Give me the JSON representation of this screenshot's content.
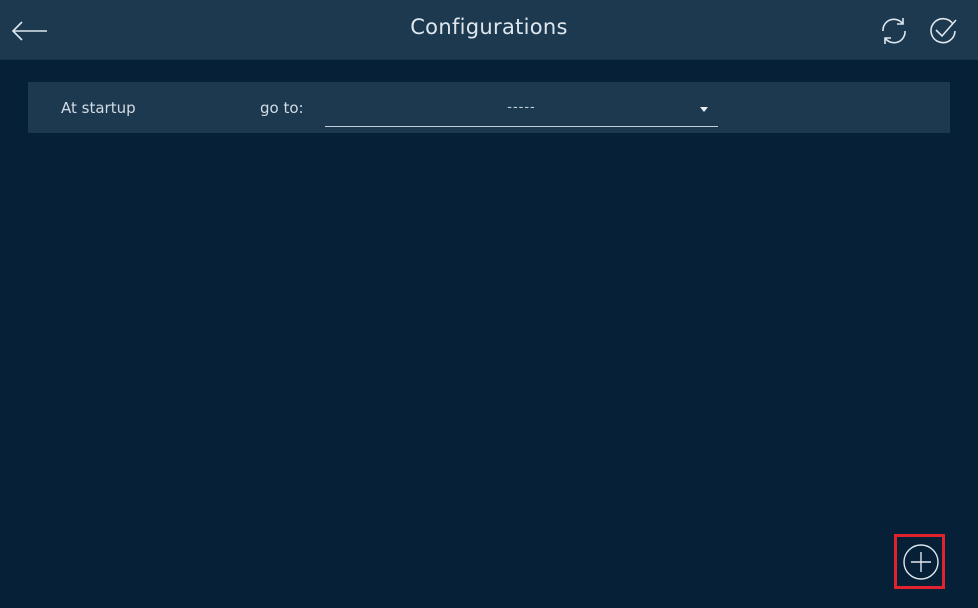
{
  "header": {
    "title": "Configurations",
    "back_icon": "arrow-left-icon",
    "refresh_icon": "refresh-icon",
    "confirm_icon": "check-circle-icon"
  },
  "startup": {
    "label": "At startup",
    "goto_label": "go to:",
    "selected_value": "-----",
    "dropdown_icon": "caret-down-icon"
  },
  "actions": {
    "add_icon": "plus-circle-icon"
  },
  "colors": {
    "background": "#062137",
    "panel": "#1c3950",
    "text": "#d3dce4",
    "highlight": "#e0232c"
  }
}
